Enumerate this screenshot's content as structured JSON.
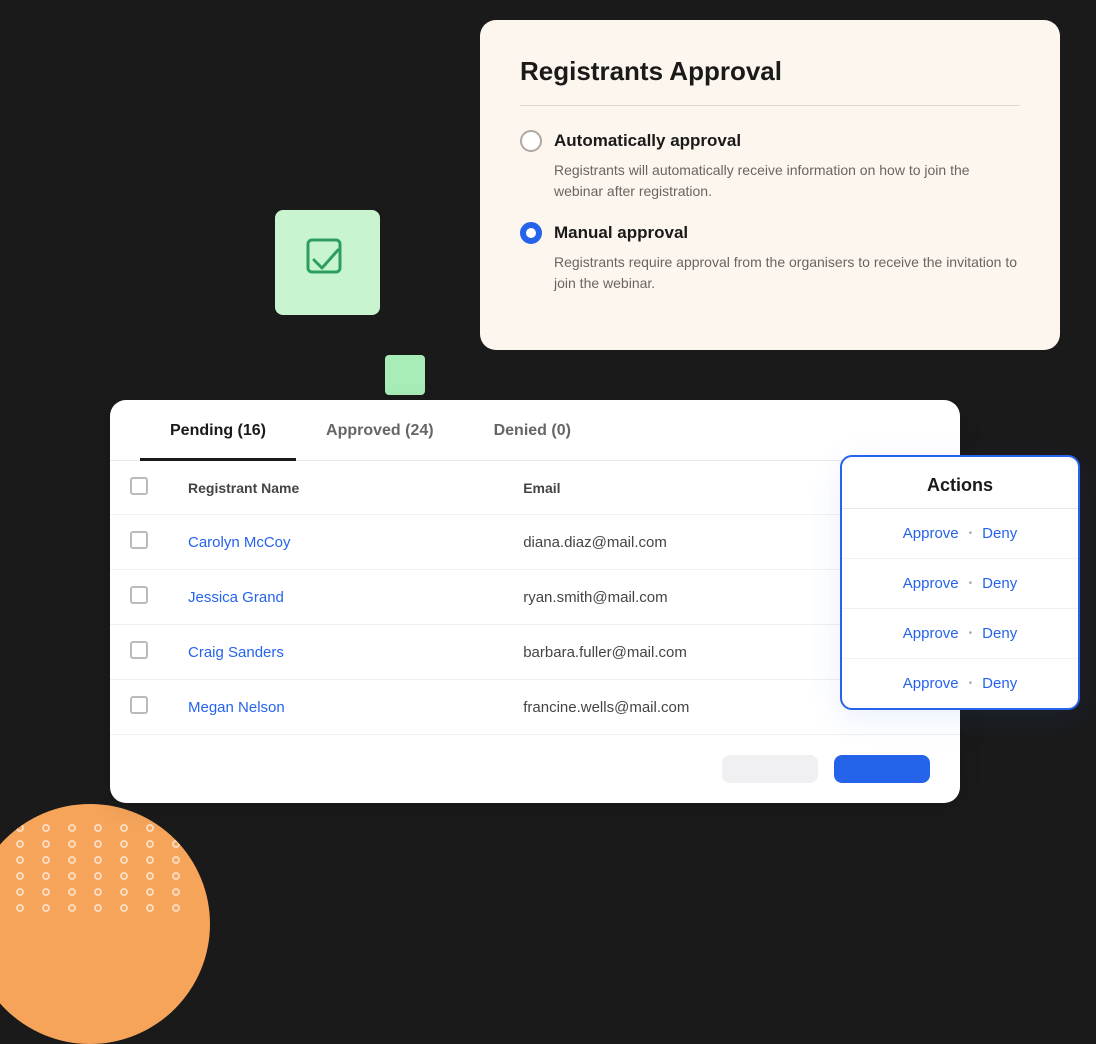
{
  "decorations": {
    "green_square_icon": "checkbox-check-icon",
    "orange_circle": true
  },
  "approval_card": {
    "title": "Registrants Approval",
    "options": [
      {
        "id": "auto",
        "label": "Automatically approval",
        "description": "Registrants will automatically receive information on how to join the webinar after registration.",
        "selected": false
      },
      {
        "id": "manual",
        "label": "Manual approval",
        "description": "Registrants require approval from the organisers to receive the invitation to join the webinar.",
        "selected": true
      }
    ]
  },
  "table_card": {
    "tabs": [
      {
        "label": "Pending (16)",
        "active": true
      },
      {
        "label": "Approved (24)",
        "active": false
      },
      {
        "label": "Denied (0)",
        "active": false
      }
    ],
    "columns": [
      "Registrant Name",
      "Email"
    ],
    "rows": [
      {
        "name": "Carolyn McCoy",
        "email": "diana.diaz@mail.com"
      },
      {
        "name": "Jessica Grand",
        "email": "ryan.smith@mail.com"
      },
      {
        "name": "Craig Sanders",
        "email": "barbara.fuller@mail.com"
      },
      {
        "name": "Megan Nelson",
        "email": "francine.wells@mail.com"
      }
    ],
    "buttons": {
      "cancel_label": "",
      "confirm_label": ""
    }
  },
  "actions_card": {
    "title": "Actions",
    "rows": [
      {
        "approve": "Approve",
        "dot": "•",
        "deny": "Deny"
      },
      {
        "approve": "Approve",
        "dot": "•",
        "deny": "Deny"
      },
      {
        "approve": "Approve",
        "dot": "•",
        "deny": "Deny"
      },
      {
        "approve": "Approve",
        "dot": "•",
        "deny": "Deny"
      }
    ]
  }
}
